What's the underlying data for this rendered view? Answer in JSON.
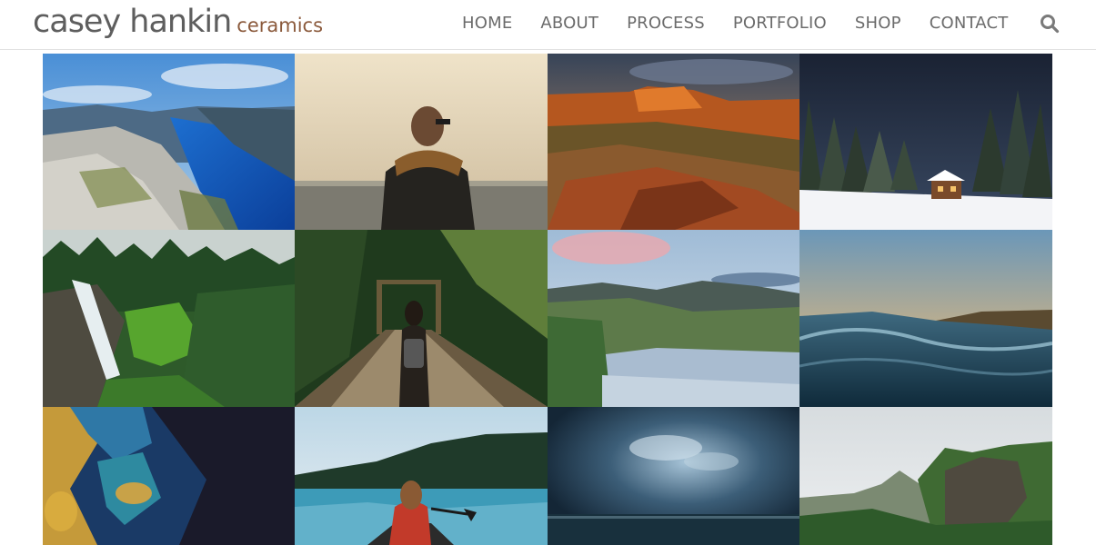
{
  "site": {
    "logo_main": "casey hankin",
    "logo_sub": "ceramics"
  },
  "nav": {
    "items": [
      "HOME",
      "ABOUT",
      "PROCESS",
      "PORTFOLIO",
      "SHOP",
      "CONTACT"
    ],
    "search_icon": "search-icon"
  },
  "colors": {
    "logo_main": "#5e5e5e",
    "logo_sub": "#8b5a3c",
    "nav_text": "#6b6b6b",
    "header_border": "#e2e2e2"
  }
}
